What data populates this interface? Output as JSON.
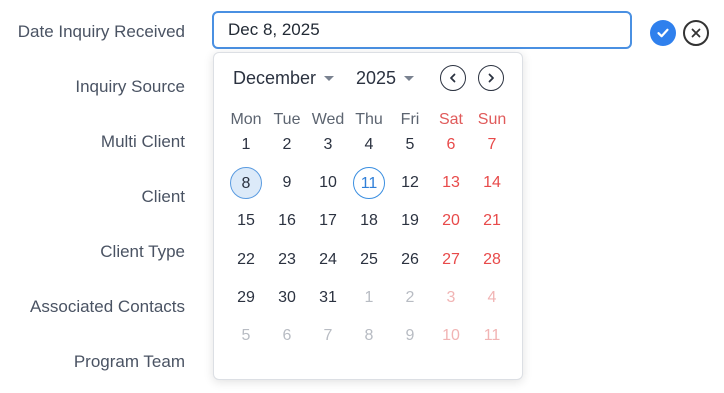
{
  "form": {
    "labels": [
      "Date Inquiry Received",
      "Inquiry Source",
      "Multi Client",
      "Client",
      "Client Type",
      "Associated Contacts",
      "Program Team"
    ],
    "date_value": "Dec 8, 2025"
  },
  "calendar": {
    "month": "December",
    "year": "2025",
    "weekdays": [
      "Mon",
      "Tue",
      "Wed",
      "Thu",
      "Fri",
      "Sat",
      "Sun"
    ],
    "weeks": [
      [
        "1",
        "2",
        "3",
        "4",
        "5",
        "6",
        "7"
      ],
      [
        "8",
        "9",
        "10",
        "11",
        "12",
        "13",
        "14"
      ],
      [
        "15",
        "16",
        "17",
        "18",
        "19",
        "20",
        "21"
      ],
      [
        "22",
        "23",
        "24",
        "25",
        "26",
        "27",
        "28"
      ],
      [
        "29",
        "30",
        "31",
        "1",
        "2",
        "3",
        "4"
      ],
      [
        "5",
        "6",
        "7",
        "8",
        "9",
        "10",
        "11"
      ]
    ],
    "selected_day": "8",
    "today_day": "11"
  },
  "icons": {
    "confirm": "check-circle-icon",
    "cancel": "close-circle-icon",
    "prev": "chevron-left-icon",
    "next": "chevron-right-icon"
  },
  "colors": {
    "accent": "#2f80ed",
    "weekend": "#e84a4a",
    "selected_bg": "#dceaf9"
  }
}
